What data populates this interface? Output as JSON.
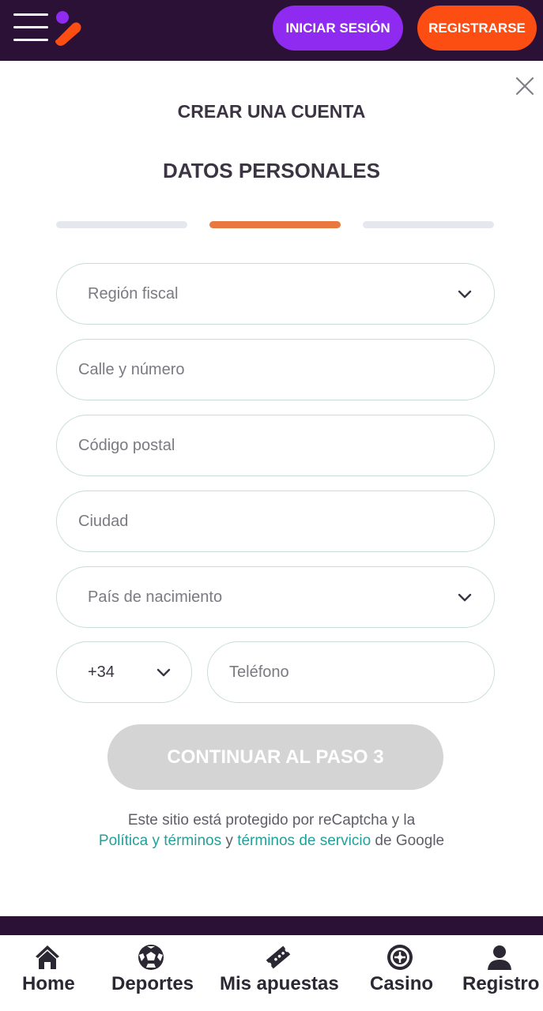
{
  "header": {
    "login_label": "INICIAR SESIÓN",
    "register_label": "REGISTRARSE",
    "background_color": "#2c1137",
    "login_color": "#8f2bf0",
    "register_color": "#fc4d13",
    "icons": {
      "menu": "hamburger-menu-icon",
      "logo": "brand-logo"
    }
  },
  "form": {
    "title": "CREAR UNA CUENTA",
    "subtitle": "DATOS PERSONALES",
    "progress": {
      "total_steps": 3,
      "current_step": 2,
      "active_color": "#e87740",
      "inactive_color": "#e4e8ee"
    },
    "close_icon": "close-icon",
    "fields": {
      "region": {
        "placeholder": "Región fiscal",
        "type": "select"
      },
      "street": {
        "placeholder": "Calle y número"
      },
      "postal": {
        "placeholder": "Código postal"
      },
      "city": {
        "placeholder": "Ciudad"
      },
      "birth_country": {
        "placeholder": "País de nacimiento",
        "type": "select"
      },
      "phone_prefix": {
        "value": "+34",
        "type": "select"
      },
      "phone": {
        "placeholder": "Teléfono"
      }
    },
    "continue_label": "CONTINUAR AL PASO 3",
    "continue_disabled_color": "#d4d4d4"
  },
  "legal": {
    "text_1": "Este sitio está protegido por reCaptcha y la",
    "link_policy": "Política y términos",
    "text_2": "y",
    "link_service": "términos de servicio",
    "text_3": "de Google",
    "link_color": "#23a09a"
  },
  "bottom_nav": {
    "items": [
      {
        "label": "Home",
        "icon": "home-icon"
      },
      {
        "label": "Deportes",
        "icon": "soccer-ball-icon"
      },
      {
        "label": "Mis apuestas",
        "icon": "ticket-icon"
      },
      {
        "label": "Casino",
        "icon": "roulette-icon"
      },
      {
        "label": "Registro",
        "icon": "user-icon"
      }
    ]
  }
}
